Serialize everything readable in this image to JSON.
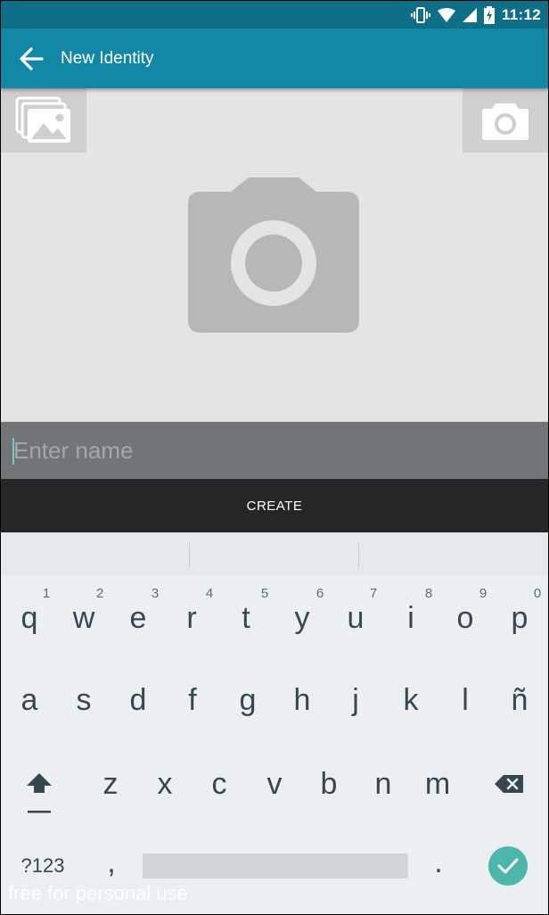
{
  "status_bar": {
    "time": "11:12",
    "icons": [
      "vibrate-icon",
      "wifi-icon",
      "signal-icon",
      "battery-charging-icon"
    ]
  },
  "app_bar": {
    "title": "New Identity",
    "back_icon": "arrow-back-icon"
  },
  "photo": {
    "gallery_icon": "gallery-icon",
    "camera_icon": "camera-icon",
    "placeholder_icon": "camera-placeholder-icon"
  },
  "name_input": {
    "placeholder": "Enter name",
    "value": ""
  },
  "create_button": {
    "label": "CREATE"
  },
  "keyboard": {
    "row1": [
      {
        "key": "q",
        "hint": "1"
      },
      {
        "key": "w",
        "hint": "2"
      },
      {
        "key": "e",
        "hint": "3"
      },
      {
        "key": "r",
        "hint": "4"
      },
      {
        "key": "t",
        "hint": "5"
      },
      {
        "key": "y",
        "hint": "6"
      },
      {
        "key": "u",
        "hint": "7"
      },
      {
        "key": "i",
        "hint": "8"
      },
      {
        "key": "o",
        "hint": "9"
      },
      {
        "key": "p",
        "hint": "0"
      }
    ],
    "row2": [
      "a",
      "s",
      "d",
      "f",
      "g",
      "h",
      "j",
      "k",
      "l",
      "ñ"
    ],
    "row3": [
      "z",
      "x",
      "c",
      "v",
      "b",
      "n",
      "m"
    ],
    "symbols_label": "?123",
    "comma_label": ",",
    "period_label": ".",
    "shift_icon": "shift-icon",
    "backspace_icon": "backspace-icon",
    "enter_icon": "check-icon"
  },
  "watermark": "free for personal use",
  "colors": {
    "status_bar": "#0f6f86",
    "app_bar": "#1288a6",
    "accent": "#4db6ac",
    "create_button": "#262626"
  }
}
